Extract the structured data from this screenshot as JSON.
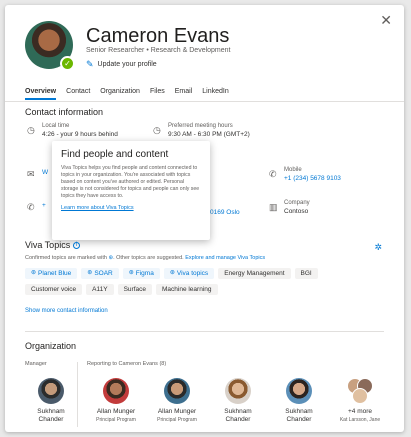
{
  "profile": {
    "name": "Cameron Evans",
    "title": "Senior Researcher",
    "separator": "•",
    "department": "Research & Development",
    "update_label": "Update your profile",
    "presence": "available"
  },
  "tabs": [
    "Overview",
    "Contact",
    "Organization",
    "Files",
    "Email",
    "LinkedIn"
  ],
  "contact": {
    "title": "Contact information",
    "local_time_label": "Local time",
    "local_time_value": "4:26 - your 9 hours behind",
    "preferred_label": "Preferred meeting hours",
    "preferred_value": "9:30 AM - 6:30 PM (GMT+2)",
    "mobile_label": "Mobile",
    "mobile_value": "+1 (234) 5678 9103",
    "company_label": "Company",
    "company_value": "Contoso",
    "partial_left_1": "W",
    "partial_left_2": "+",
    "partial_right": "0169 Oslo"
  },
  "popup": {
    "title": "Find people and content",
    "body": "Viva Topics helps you find people and content connected to topics in your organization. You're associated with topics based on content you've authored or edited. Personal storage is not considered for topics and people can only see topics they have access to.",
    "link": "Learn more about Viva Topics"
  },
  "viva": {
    "title": "Viva Topics",
    "note_prefix": "Confirmed topics are marked with",
    "note_mid": ". Other topics are suggested.",
    "note_link": "Explore and manage Viva Topics",
    "chips": [
      {
        "label": "Planet Blue",
        "topic": true
      },
      {
        "label": "SOAR",
        "topic": true
      },
      {
        "label": "Figma",
        "topic": true
      },
      {
        "label": "Viva topics",
        "topic": true
      },
      {
        "label": "Energy Management",
        "topic": false
      },
      {
        "label": "BGI",
        "topic": false
      },
      {
        "label": "Customer voice",
        "topic": false
      },
      {
        "label": "A11Y",
        "topic": false
      },
      {
        "label": "Surface",
        "topic": false
      },
      {
        "label": "Machine learning",
        "topic": false
      }
    ],
    "show_more": "Show more contact information"
  },
  "organization": {
    "title": "Organization",
    "manager_label": "Manager",
    "reporting_label": "Reporting to Cameron Evans (8)",
    "manager": {
      "first": "Sukhnam",
      "last": "Chander",
      "role": ""
    },
    "reports": [
      {
        "first": "Allan Munger",
        "last": "Principal Program",
        "role": ""
      },
      {
        "first": "Allan Munger",
        "last": "Principal Program",
        "role": ""
      },
      {
        "first": "Sukhnam",
        "last": "Chander",
        "role": ""
      },
      {
        "first": "Sukhnam",
        "last": "Chander",
        "role": ""
      },
      {
        "first": "+4 more",
        "last": "Kat Larsson, Jane",
        "role": ""
      }
    ]
  },
  "colors": {
    "accent": "#0078d4",
    "presence": "#6bb700"
  }
}
